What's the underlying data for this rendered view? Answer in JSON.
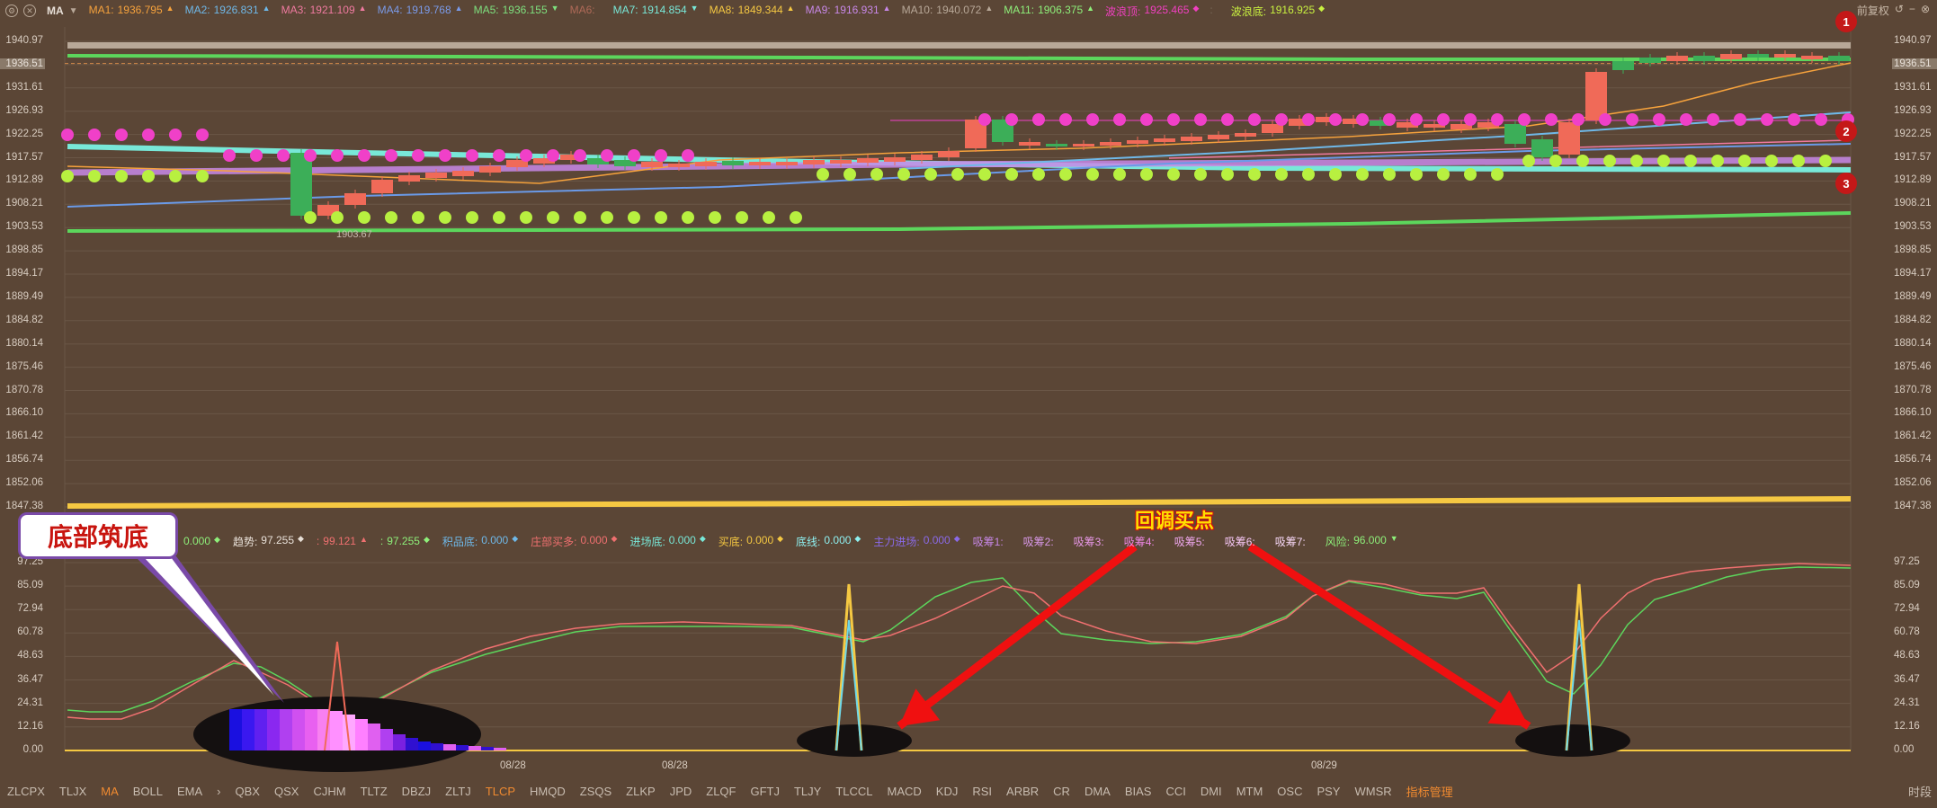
{
  "topbar": {
    "indicator_name": "MA",
    "ma_items": [
      {
        "label": "MA1:",
        "value": "1936.795",
        "dir": "▲",
        "color": "#f6a23c"
      },
      {
        "label": "MA2:",
        "value": "1926.831",
        "dir": "▲",
        "color": "#6fb8e8"
      },
      {
        "label": "MA3:",
        "value": "1921.109",
        "dir": "▲",
        "color": "#f07aa0"
      },
      {
        "label": "MA4:",
        "value": "1919.768",
        "dir": "▲",
        "color": "#7a9ae8"
      },
      {
        "label": "MA5:",
        "value": "1936.155",
        "dir": "▼",
        "color": "#7ee07e"
      },
      {
        "label": "MA6:",
        "value": "",
        "dir": "",
        "color": "#b06a58"
      },
      {
        "label": "MA7:",
        "value": "1914.854",
        "dir": "▼",
        "color": "#78e8d8"
      },
      {
        "label": "MA8:",
        "value": "1849.344",
        "dir": "▲",
        "color": "#f5c842"
      },
      {
        "label": "MA9:",
        "value": "1916.931",
        "dir": "▲",
        "color": "#c888e8"
      },
      {
        "label": "MA10:",
        "value": "1940.072",
        "dir": "▲",
        "color": "#b8a898"
      },
      {
        "label": "MA11:",
        "value": "1906.375",
        "dir": "▲",
        "color": "#8ef07a"
      },
      {
        "label": "波浪顶:",
        "value": "1925.465",
        "dir": "◆",
        "color": "#f040c0"
      },
      {
        "label": ":",
        "value": "",
        "dir": "",
        "color": "#7a6a5a"
      },
      {
        "label": "波浪底:",
        "value": "1916.925",
        "dir": "◆",
        "color": "#c8f040"
      }
    ],
    "right_label": "前复权",
    "right_icons": [
      "↺",
      "−",
      "⊗"
    ]
  },
  "main_axis_labels": [
    "1940.97",
    "1936.51",
    "1931.61",
    "1926.93",
    "1922.25",
    "1917.57",
    "1912.89",
    "1908.21",
    "1903.53",
    "1898.85",
    "1894.17",
    "1889.49",
    "1884.82",
    "1880.14",
    "1875.46",
    "1870.78",
    "1866.10",
    "1861.42",
    "1856.74",
    "1852.06",
    "1847.38"
  ],
  "current_price_tag": "1936.51",
  "low_price_label": "1903.67",
  "markers": [
    "1",
    "2",
    "3"
  ],
  "sub_axis_labels": [
    "97.25",
    "85.09",
    "72.94",
    "60.78",
    "48.63",
    "36.47",
    "24.31",
    "12.16",
    "0.00"
  ],
  "sub_legend": [
    {
      "label": "",
      "value": "0.000",
      "dir": "◆",
      "color": "#8ef07a"
    },
    {
      "label": "趋势:",
      "value": "97.255",
      "dir": "◆",
      "color": "#e8e0d8"
    },
    {
      "label": ":",
      "value": "99.121",
      "dir": "▲",
      "color": "#f07070"
    },
    {
      "label": ":",
      "value": "97.255",
      "dir": "◆",
      "color": "#8ef07a"
    },
    {
      "label": "积品底:",
      "value": "0.000",
      "dir": "◆",
      "color": "#6fb8e8"
    },
    {
      "label": "庄部买多:",
      "value": "0.000",
      "dir": "◆",
      "color": "#f07070"
    },
    {
      "label": "进场底:",
      "value": "0.000",
      "dir": "◆",
      "color": "#78e8d8"
    },
    {
      "label": "买底:",
      "value": "0.000",
      "dir": "◆",
      "color": "#f5c842"
    },
    {
      "label": "底线:",
      "value": "0.000",
      "dir": "◆",
      "color": "#8ef0f0"
    },
    {
      "label": "主力进场:",
      "value": "0.000",
      "dir": "◆",
      "color": "#8a6ae8"
    },
    {
      "label": "吸筹1:",
      "value": "",
      "dir": "",
      "color": "#c888e8"
    },
    {
      "label": "吸筹2:",
      "value": "",
      "dir": "",
      "color": "#d898e8"
    },
    {
      "label": "吸筹3:",
      "value": "",
      "dir": "",
      "color": "#e898e8"
    },
    {
      "label": "吸筹4:",
      "value": "",
      "dir": "",
      "color": "#f088e8"
    },
    {
      "label": "吸筹5:",
      "value": "",
      "dir": "",
      "color": "#f0a8f0"
    },
    {
      "label": "吸筹6:",
      "value": "",
      "dir": "",
      "color": "#f8c8f8"
    },
    {
      "label": "吸筹7:",
      "value": "",
      "dir": "",
      "color": "#f8d8f8"
    },
    {
      "label": "风险:",
      "value": "96.000",
      "dir": "▼",
      "color": "#8ef07a"
    }
  ],
  "date_labels": [
    "08/28",
    "08/28",
    "08/29"
  ],
  "callout_text": "底部筑底",
  "buy_point_label": "回调买点",
  "tabs": [
    {
      "label": "ZLCPX",
      "state": "normal"
    },
    {
      "label": "TLJX",
      "state": "normal"
    },
    {
      "label": "MA",
      "state": "active"
    },
    {
      "label": "BOLL",
      "state": "normal"
    },
    {
      "label": "EMA",
      "state": "normal"
    },
    {
      "label": "›",
      "state": "normal"
    },
    {
      "label": "QBX",
      "state": "normal"
    },
    {
      "label": "QSX",
      "state": "normal"
    },
    {
      "label": "CJHM",
      "state": "normal"
    },
    {
      "label": "TLTZ",
      "state": "normal"
    },
    {
      "label": "DBZJ",
      "state": "normal"
    },
    {
      "label": "ZLTJ",
      "state": "normal"
    },
    {
      "label": "TLCP",
      "state": "active"
    },
    {
      "label": "HMQD",
      "state": "normal"
    },
    {
      "label": "ZSQS",
      "state": "normal"
    },
    {
      "label": "ZLKP",
      "state": "normal"
    },
    {
      "label": "JPD",
      "state": "normal"
    },
    {
      "label": "ZLQF",
      "state": "normal"
    },
    {
      "label": "GFTJ",
      "state": "normal"
    },
    {
      "label": "TLJY",
      "state": "normal"
    },
    {
      "label": "TLCCL",
      "state": "normal"
    },
    {
      "label": "MACD",
      "state": "normal"
    },
    {
      "label": "KDJ",
      "state": "normal"
    },
    {
      "label": "RSI",
      "state": "normal"
    },
    {
      "label": "ARBR",
      "state": "normal"
    },
    {
      "label": "CR",
      "state": "normal"
    },
    {
      "label": "DMA",
      "state": "normal"
    },
    {
      "label": "BIAS",
      "state": "normal"
    },
    {
      "label": "CCI",
      "state": "normal"
    },
    {
      "label": "DMI",
      "state": "normal"
    },
    {
      "label": "MTM",
      "state": "normal"
    },
    {
      "label": "OSC",
      "state": "normal"
    },
    {
      "label": "PSY",
      "state": "normal"
    },
    {
      "label": "WMSR",
      "state": "normal"
    },
    {
      "label": "指标管理",
      "state": "active"
    }
  ],
  "tab_right": "时段",
  "colors": {
    "background": "#5b4636",
    "bull": "#f06a58",
    "bear": "#3cae58",
    "wave_top": "#f040c8",
    "wave_bottom": "#b8f040"
  }
}
